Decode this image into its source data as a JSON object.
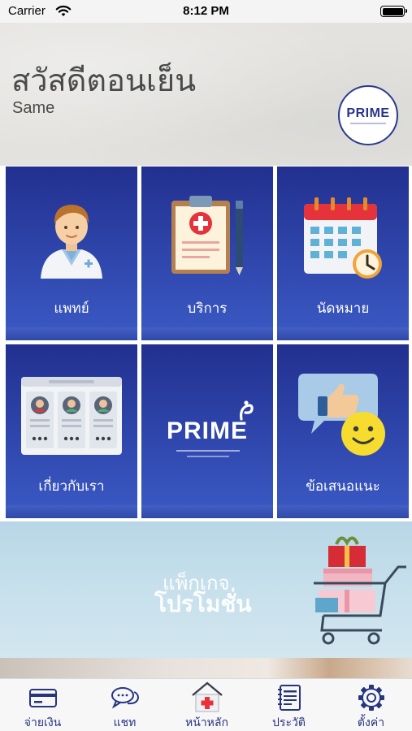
{
  "status_bar": {
    "carrier": "Carrier",
    "time": "8:12 PM"
  },
  "header": {
    "greeting": "สวัสดีตอนเย็น",
    "username": "Same",
    "logo_text": "PRIME"
  },
  "menu": [
    {
      "label": "แพทย์",
      "icon": "doctor-icon"
    },
    {
      "label": "บริการ",
      "icon": "clipboard-medical-icon"
    },
    {
      "label": "นัดหมาย",
      "icon": "calendar-clock-icon"
    },
    {
      "label": "เกี่ยวกับเรา",
      "icon": "team-profiles-icon"
    },
    {
      "label": "",
      "icon": "prime-logo",
      "logo_text": "PRIME"
    },
    {
      "label": "ข้อเสนอแนะ",
      "icon": "feedback-thumbs-up-icon"
    }
  ],
  "promo": {
    "line1": "แพ็กเกจ",
    "line2": "โปรโมชั่น"
  },
  "tabbar": [
    {
      "label": "จ่ายเงิน",
      "icon": "payment-card-icon"
    },
    {
      "label": "แชท",
      "icon": "chat-bubbles-icon"
    },
    {
      "label": "หน้าหลัก",
      "icon": "home-cross-icon"
    },
    {
      "label": "ประวัติ",
      "icon": "history-notebook-icon"
    },
    {
      "label": "ตั้งค่า",
      "icon": "gear-icon"
    }
  ],
  "colors": {
    "brand": "#27358a",
    "tile_top": "#22308f",
    "tile_bottom": "#3b5ac5",
    "accent_red": "#e5323b"
  }
}
